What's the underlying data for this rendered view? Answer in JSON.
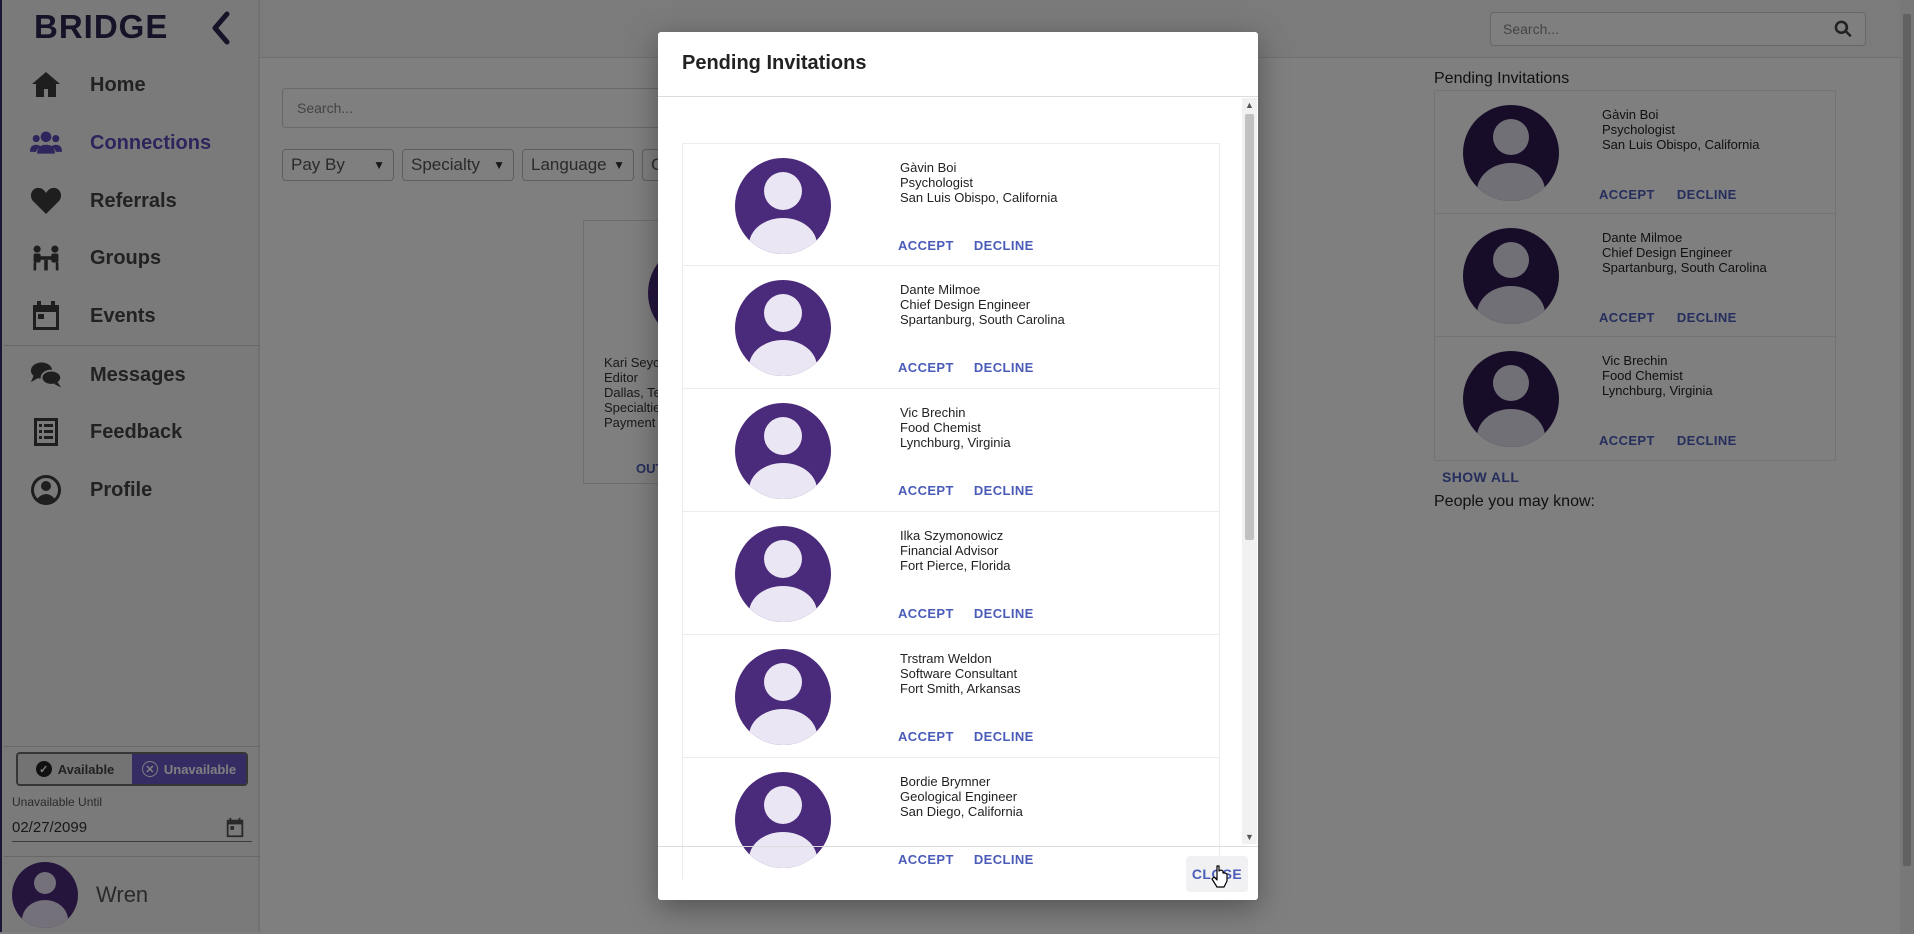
{
  "app": {
    "brand": "BRIDGE"
  },
  "sidebar": {
    "items": [
      {
        "label": "Home",
        "icon": "home-icon"
      },
      {
        "label": "Connections",
        "icon": "users-icon",
        "active": true
      },
      {
        "label": "Referrals",
        "icon": "heart-icon"
      },
      {
        "label": "Groups",
        "icon": "group-table-icon"
      },
      {
        "label": "Events",
        "icon": "calendar-icon"
      },
      {
        "label": "Messages",
        "icon": "chat-icon"
      },
      {
        "label": "Feedback",
        "icon": "clipboard-icon"
      },
      {
        "label": "Profile",
        "icon": "user-circle-icon"
      }
    ],
    "availability": {
      "available_label": "Available",
      "unavailable_label": "Unavailable",
      "selected": "Unavailable"
    },
    "unavailable_until": {
      "label": "Unavailable Until",
      "value": "02/27/2099"
    },
    "user": {
      "name": "Wren"
    }
  },
  "topbar": {
    "search_placeholder": "Search..."
  },
  "main": {
    "search_placeholder": "Search...",
    "filters": [
      "Pay By",
      "Specialty",
      "Language",
      "C"
    ],
    "card": {
      "lines": [
        "Kari Seyc",
        "Editor",
        "Dallas, Te",
        "Specialtie",
        "Payment"
      ],
      "action": "OUT"
    }
  },
  "right_panel": {
    "title": "Pending Invitations",
    "items": [
      {
        "name": "Gàvin Boi",
        "title": "Psychologist",
        "location": "San Luis Obispo, California"
      },
      {
        "name": "Dante Milmoe",
        "title": "Chief Design Engineer",
        "location": "Spartanburg, South Carolina"
      },
      {
        "name": "Vic Brechin",
        "title": "Food Chemist",
        "location": "Lynchburg, Virginia"
      }
    ],
    "accept_label": "ACCEPT",
    "decline_label": "DECLINE",
    "show_all": "SHOW ALL",
    "people_title": "People you may know:"
  },
  "modal": {
    "title": "Pending Invitations",
    "accept_label": "ACCEPT",
    "decline_label": "DECLINE",
    "close_label": "CLOSE",
    "invitations": [
      {
        "name": "Gàvin Boi",
        "title": "Psychologist",
        "location": "San Luis Obispo, California"
      },
      {
        "name": "Dante Milmoe",
        "title": "Chief Design Engineer",
        "location": "Spartanburg, South Carolina"
      },
      {
        "name": "Vic Brechin",
        "title": "Food Chemist",
        "location": "Lynchburg, Virginia"
      },
      {
        "name": "Ilka Szymonowicz",
        "title": "Financial Advisor",
        "location": "Fort Pierce, Florida"
      },
      {
        "name": "Trstram Weldon",
        "title": "Software Consultant",
        "location": "Fort Smith, Arkansas"
      },
      {
        "name": "Bordie Brymner",
        "title": "Geological Engineer",
        "location": "San Diego, California"
      }
    ]
  },
  "colors": {
    "accent": "#5b4bb8",
    "link": "#4a5cb8",
    "avatar": "#4a2a7a",
    "toggle_on": "#6a58c9"
  }
}
